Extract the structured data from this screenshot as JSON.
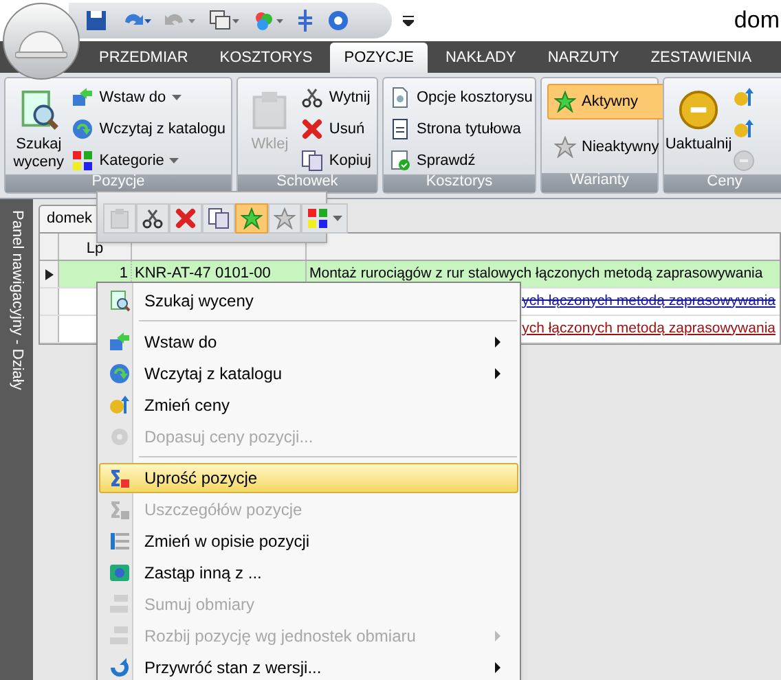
{
  "app": {
    "title": "dom"
  },
  "tabs": [
    {
      "label": "PRZEDMIAR",
      "selected": false
    },
    {
      "label": "KOSZTORYS",
      "selected": false
    },
    {
      "label": "POZYCJE",
      "selected": true
    },
    {
      "label": "NAKŁADY",
      "selected": false
    },
    {
      "label": "NARZUTY",
      "selected": false
    },
    {
      "label": "ZESTAWIENIA",
      "selected": false
    }
  ],
  "ribbon": {
    "groups": [
      {
        "label": "Pozycje",
        "buttons": [
          {
            "kind": "large",
            "label": "Szukaj wyceny",
            "disabled": false
          },
          {
            "kind": "small",
            "label": "Wstaw do",
            "dropdown": true
          },
          {
            "kind": "small",
            "label": "Wczytaj z katalogu",
            "dropdown": false
          },
          {
            "kind": "small",
            "label": "Kategorie",
            "dropdown": true
          }
        ]
      },
      {
        "label": "Schowek",
        "buttons": [
          {
            "kind": "large",
            "label": "Wklej",
            "disabled": true
          },
          {
            "kind": "small",
            "label": "Wytnij",
            "dropdown": false
          },
          {
            "kind": "small",
            "label": "Usuń",
            "dropdown": false
          },
          {
            "kind": "small",
            "label": "Kopiuj",
            "dropdown": false
          }
        ]
      },
      {
        "label": "Kosztorys",
        "buttons": [
          {
            "kind": "small",
            "label": "Opcje kosztorysu",
            "dropdown": false
          },
          {
            "kind": "small",
            "label": "Strona tytułowa",
            "dropdown": false
          },
          {
            "kind": "small",
            "label": "Sprawdź",
            "dropdown": false
          }
        ]
      },
      {
        "label": "Warianty",
        "buttons": [
          {
            "kind": "toggle",
            "label": "Aktywny",
            "selected": true
          },
          {
            "kind": "toggle",
            "label": "Nieaktywny",
            "selected": false
          }
        ]
      },
      {
        "label": "Ceny",
        "buttons": [
          {
            "kind": "large",
            "label": "Uaktualnij",
            "disabled": false
          },
          {
            "kind": "icon",
            "disabled": false
          },
          {
            "kind": "icon",
            "disabled": false
          },
          {
            "kind": "icon",
            "disabled": true
          }
        ]
      }
    ]
  },
  "side_panel": {
    "label": "Panel nawigacyjny - Działy"
  },
  "document_tab": {
    "label": "domek"
  },
  "grid": {
    "columns": [
      "Lp"
    ],
    "rows": [
      {
        "selected": true,
        "lp": "1",
        "code": "KNR-AT-47 0101-00",
        "description": "Montaż rurociągów z rur stalowych łączonych metodą zaprasowywania",
        "color": "#000000",
        "strikethrough": false
      },
      {
        "selected": false,
        "description": "ych łączonych metodą zaprasowywania",
        "color": "#1a1aa0",
        "strikethrough": true
      },
      {
        "selected": false,
        "description": "ych łączonych metodą zaprasowywania",
        "color": "#a01010",
        "strikethrough": false
      }
    ]
  },
  "mini_toolbar": [
    {
      "disabled": true,
      "selected": false
    },
    {
      "disabled": false,
      "selected": false
    },
    {
      "disabled": false,
      "selected": false
    },
    {
      "disabled": false,
      "selected": false
    },
    {
      "disabled": false,
      "selected": true
    },
    {
      "disabled": false,
      "selected": false
    },
    {
      "disabled": false,
      "selected": false,
      "dropdown": true
    }
  ],
  "context_menu": [
    {
      "kind": "item",
      "label": "Szukaj wyceny",
      "disabled": false,
      "submenu": false,
      "selected": false
    },
    {
      "kind": "separator"
    },
    {
      "kind": "item",
      "label": "Wstaw do",
      "disabled": false,
      "submenu": true,
      "selected": false
    },
    {
      "kind": "item",
      "label": "Wczytaj z katalogu",
      "disabled": false,
      "submenu": true,
      "selected": false
    },
    {
      "kind": "item",
      "label": "Zmień ceny",
      "disabled": false,
      "submenu": false,
      "selected": false
    },
    {
      "kind": "item",
      "label": "Dopasuj ceny pozycji...",
      "disabled": true,
      "submenu": false,
      "selected": false
    },
    {
      "kind": "separator"
    },
    {
      "kind": "item",
      "label": "Uprość pozycje",
      "disabled": false,
      "submenu": false,
      "selected": true
    },
    {
      "kind": "item",
      "label": "Uszczegółów pozycje",
      "disabled": true,
      "submenu": false,
      "selected": false
    },
    {
      "kind": "item",
      "label": "Zmień w opisie pozycji",
      "disabled": false,
      "submenu": false,
      "selected": false
    },
    {
      "kind": "item",
      "label": "Zastąp inną z ...",
      "disabled": false,
      "submenu": false,
      "selected": false
    },
    {
      "kind": "item",
      "label": "Sumuj obmiary",
      "disabled": true,
      "submenu": false,
      "selected": false
    },
    {
      "kind": "item",
      "label": "Rozbij pozycję wg jednostek obmiaru",
      "disabled": true,
      "submenu": true,
      "selected": false
    },
    {
      "kind": "item",
      "label": "Przywróć stan z wersji...",
      "disabled": false,
      "submenu": true,
      "selected": false
    }
  ]
}
